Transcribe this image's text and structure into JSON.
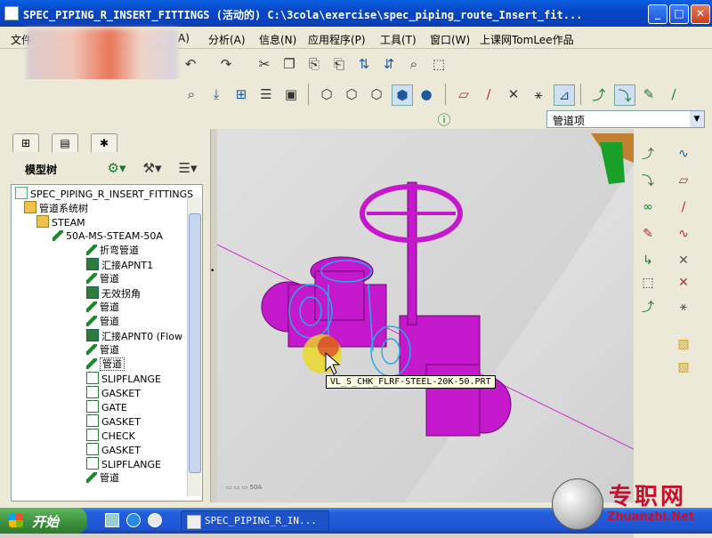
{
  "window": {
    "title": "SPEC_PIPING_R_INSERT_FITTINGS (活动的) C:\\3cola\\exercise\\spec_piping_route_Insert_fit...",
    "minimize": "_",
    "maximize": "□",
    "close": "✕"
  },
  "menu": {
    "items": [
      "文件",
      "A)",
      "分析(A)",
      "信息(N)",
      "应用程序(P)",
      "工具(T)",
      "窗口(W)",
      "上课网TomLee作品"
    ]
  },
  "project_combo": {
    "value": "管道项"
  },
  "left_panel": {
    "tree_title": "模型树",
    "tree": [
      {
        "label": "SPEC_PIPING_R_INSERT_FITTINGS",
        "icon": "doc"
      },
      {
        "label": "管道系统树",
        "icon": "folder"
      },
      {
        "label": "STEAM",
        "icon": "folder"
      },
      {
        "label": "50A-MS-STEAM-50A",
        "icon": "pipe"
      },
      {
        "label": "折弯管道",
        "icon": "pipe"
      },
      {
        "label": "汇接APNT1",
        "icon": "join"
      },
      {
        "label": "管道",
        "icon": "pipe"
      },
      {
        "label": "无效拐角",
        "icon": "join"
      },
      {
        "label": "管道",
        "icon": "pipe"
      },
      {
        "label": "管道",
        "icon": "pipe"
      },
      {
        "label": "汇接APNT0 (Flow",
        "icon": "join"
      },
      {
        "label": "管道",
        "icon": "pipe"
      },
      {
        "label": "管道",
        "icon": "pipe"
      },
      {
        "label": "SLIPFLANGE",
        "icon": "fit"
      },
      {
        "label": "GASKET",
        "icon": "fit"
      },
      {
        "label": "GATE",
        "icon": "fit"
      },
      {
        "label": "GASKET",
        "icon": "fit"
      },
      {
        "label": "CHECK",
        "icon": "fit"
      },
      {
        "label": "GASKET",
        "icon": "fit"
      },
      {
        "label": "SLIPFLANGE",
        "icon": "fit"
      },
      {
        "label": "管道",
        "icon": "pipe"
      }
    ]
  },
  "viewport": {
    "tooltip": "VL_S_CHK_FLRF-STEEL-20K-50.PRT",
    "part_color": "#c020c8",
    "highlight_color": "#2aa8e8"
  },
  "taskbar": {
    "start": "开始",
    "task": "SPEC_PIPING_R_IN..."
  },
  "watermark": {
    "text": "专职网",
    "url": "Zhuanzhi.Net"
  }
}
